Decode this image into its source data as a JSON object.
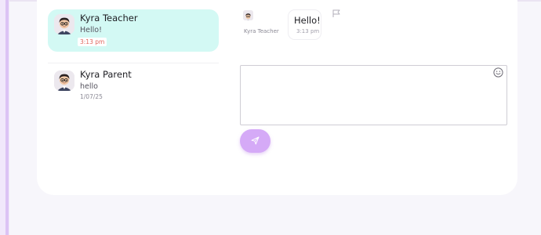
{
  "conversations": [
    {
      "name": "Kyra Teacher",
      "last_message": "Hello!",
      "time": "3:13 pm",
      "active": true
    },
    {
      "name": "Kyra Parent",
      "last_message": "hello",
      "time": "1/07/25",
      "active": false
    }
  ],
  "thread": {
    "sender": "Kyra Teacher",
    "message": "Hello!",
    "time": "3:13 pm"
  },
  "composer": {
    "placeholder": "",
    "value": ""
  },
  "icons": {
    "avatar": "avatar-icon",
    "flag": "flag-icon",
    "emoji": "emoji-icon",
    "send": "send-icon"
  },
  "colors": {
    "active_conversation": "#d3f9f4",
    "send_button": "#d5aaf7",
    "time_accent": "#e0655d",
    "left_rail": "#dcc3f4"
  }
}
